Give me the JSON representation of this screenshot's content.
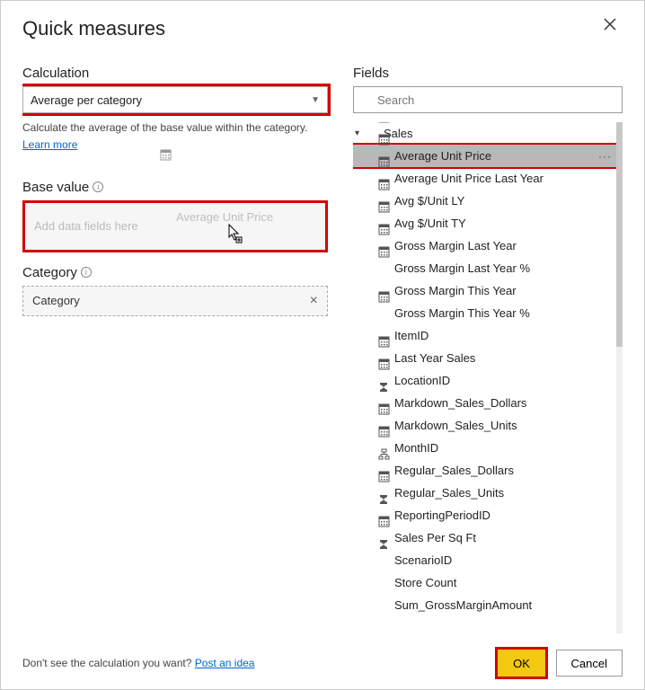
{
  "title": "Quick measures",
  "left": {
    "calculation_label": "Calculation",
    "calculation_value": "Average per category",
    "help_text": "Calculate the average of the base value within the category.",
    "learn_more": "Learn more",
    "base_value_label": "Base value",
    "drop_placeholder": "Add data fields here",
    "drag_label": "Average Unit Price",
    "category_label": "Category",
    "category_value": "Category"
  },
  "right": {
    "fields_label": "Fields",
    "search_placeholder": "Search",
    "table_name": "Sales",
    "items": [
      {
        "label": "Average Unit Price",
        "icon": "calc",
        "selected": true
      },
      {
        "label": "Average Unit Price Last Year",
        "icon": "calc"
      },
      {
        "label": "Avg $/Unit LY",
        "icon": "calc"
      },
      {
        "label": "Avg $/Unit TY",
        "icon": "calc"
      },
      {
        "label": "Gross Margin Last Year",
        "icon": "calc"
      },
      {
        "label": "Gross Margin Last Year %",
        "icon": "calc"
      },
      {
        "label": "Gross Margin This Year",
        "icon": "calc"
      },
      {
        "label": "Gross Margin This Year %",
        "icon": "calc"
      },
      {
        "label": "ItemID",
        "icon": "none"
      },
      {
        "label": "Last Year Sales",
        "icon": "calc"
      },
      {
        "label": "LocationID",
        "icon": "none"
      },
      {
        "label": "Markdown_Sales_Dollars",
        "icon": "calc"
      },
      {
        "label": "Markdown_Sales_Units",
        "icon": "calc"
      },
      {
        "label": "MonthID",
        "icon": "sigma"
      },
      {
        "label": "Regular_Sales_Dollars",
        "icon": "calc"
      },
      {
        "label": "Regular_Sales_Units",
        "icon": "calc"
      },
      {
        "label": "ReportingPeriodID",
        "icon": "hier"
      },
      {
        "label": "Sales Per Sq Ft",
        "icon": "calc"
      },
      {
        "label": "ScenarioID",
        "icon": "sigma"
      },
      {
        "label": "Store Count",
        "icon": "calc"
      },
      {
        "label": "Sum_GrossMarginAmount",
        "icon": "sigma"
      }
    ]
  },
  "footer": {
    "prompt": "Don't see the calculation you want?",
    "post_idea": "Post an idea",
    "ok": "OK",
    "cancel": "Cancel"
  }
}
